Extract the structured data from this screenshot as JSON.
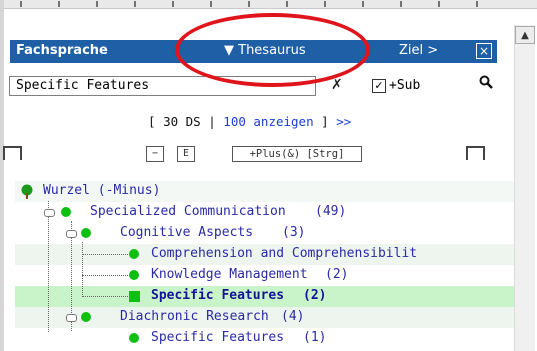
{
  "header": {
    "fachsprache": "Fachsprache",
    "thesaurus": "▼ Thesaurus",
    "ziel": "Ziel >",
    "close": "⊠"
  },
  "search": {
    "value": "Specific Features",
    "clear": "✗",
    "checkbox": "✓",
    "sub_label": "+Sub",
    "search_icon": "search-icon"
  },
  "paging": {
    "open": "[",
    "count": "30 DS",
    "sep": "|",
    "show": "100 anzeigen",
    "close": "]",
    "next": ">>"
  },
  "toolbar": {
    "collapse": "−",
    "expand": "E",
    "plus": "+Plus(&) [Strg]"
  },
  "tree": {
    "root": "Wurzel (-Minus)",
    "items": [
      {
        "label": "Specialized Communication",
        "count": "(49)"
      },
      {
        "label": "Cognitive Aspects",
        "count": "(3)"
      },
      {
        "label": "Comprehension and Comprehensibilit",
        "count": ""
      },
      {
        "label": "Knowledge Management",
        "count": "(2)"
      },
      {
        "label": "Specific Features",
        "count": "(2)"
      },
      {
        "label": "Diachronic Research",
        "count": "(4)"
      },
      {
        "label": "Specific Features",
        "count": "(1)"
      }
    ]
  },
  "colors": {
    "header_bg": "#1f5fa6",
    "selected_bg": "#c9f3c8",
    "annotation_ellipse": "#e0141b",
    "node_green": "#0fbf12"
  }
}
